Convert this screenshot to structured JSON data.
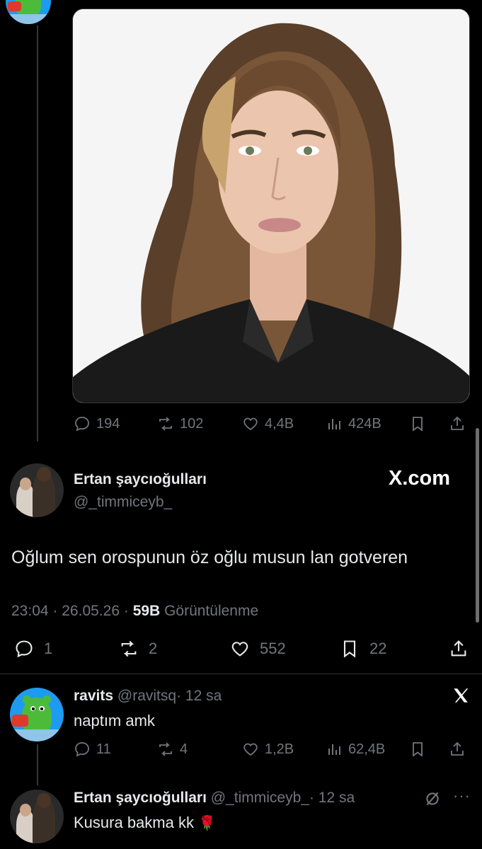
{
  "top_tweet": {
    "stats": {
      "replies": "194",
      "reposts": "102",
      "likes": "4,4B",
      "views": "424B"
    }
  },
  "main_tweet": {
    "author_name": "Ertan şaycıoğulları",
    "author_handle": "@_timmiceyb_",
    "badge_label": "X.com",
    "text": "Oğlum sen orospunun öz oğlu musun lan gotveren",
    "time": "23:04",
    "date": "26.05.26",
    "views_count": "59B",
    "views_label": "Görüntülenme",
    "separator": "·",
    "stats": {
      "replies": "1",
      "reposts": "2",
      "likes": "552",
      "bookmarks": "22"
    }
  },
  "reply1": {
    "author_name": "ravits",
    "author_handle": "@ravitsq",
    "separator": "·",
    "age": "12 sa",
    "text": "naptım amk",
    "stats": {
      "replies": "11",
      "reposts": "4",
      "likes": "1,2B",
      "views": "62,4B"
    }
  },
  "reply2": {
    "author_name": "Ertan şaycıoğulları",
    "author_handle": "@_timmiceyb_",
    "separator": "·",
    "age": "12 sa",
    "text": "Kusura bakma kk",
    "emoji": "🌹"
  },
  "colors": {
    "background": "#000000",
    "text_primary": "#e7e9ea",
    "text_secondary": "#71767b",
    "divider": "#2f3336"
  }
}
